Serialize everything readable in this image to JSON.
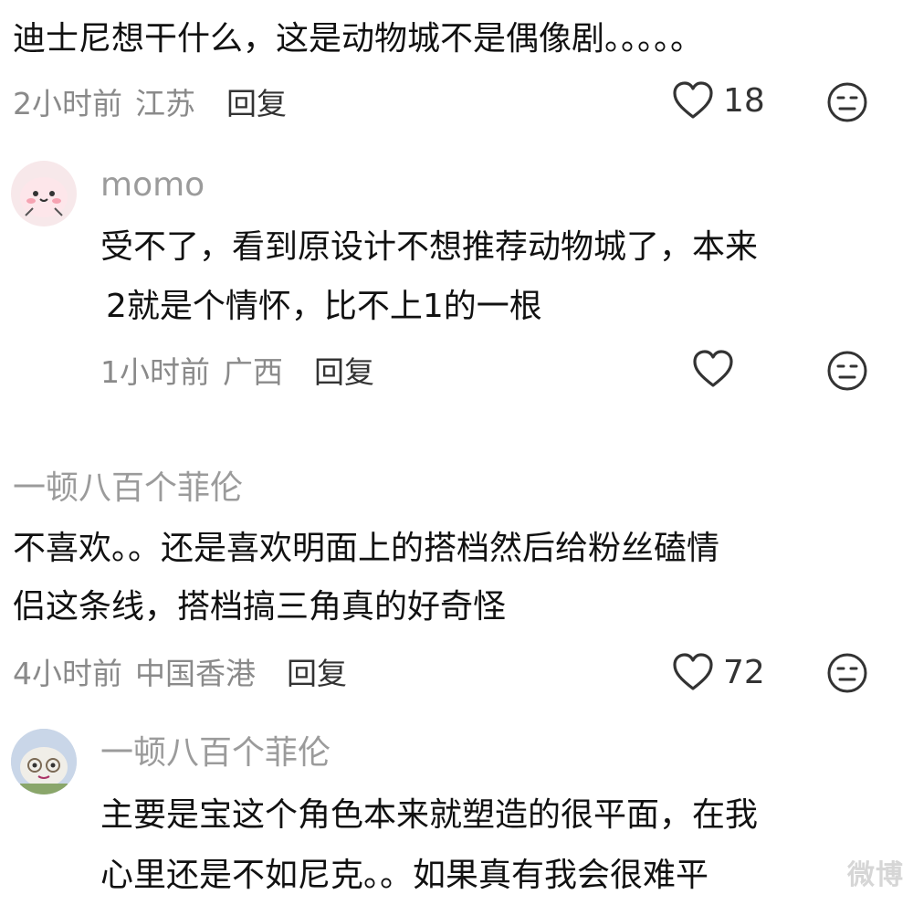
{
  "comments": [
    {
      "text": "迪士尼想干什么，这是动物城不是偶像剧。。。。。",
      "time": "2小时前",
      "location": "江苏",
      "reply_label": "回复",
      "likes": "18"
    },
    {
      "username": "momo",
      "text_line1": "受不了，看到原设计不想推荐动物城了，本来",
      "text_line2": "2就是个情怀，比不上1的一根",
      "time": "1小时前",
      "location": "广西",
      "reply_label": "回复",
      "likes": ""
    },
    {
      "username": "一顿八百个菲伦",
      "text_line1": "不喜欢。。还是喜欢明面上的搭档然后给粉丝磕情",
      "text_line2": "侣这条线，搭档搞三角真的好奇怪",
      "time": "4小时前",
      "location": "中国香港",
      "reply_label": "回复",
      "likes": "72"
    },
    {
      "username": "一顿八百个菲伦",
      "text_line1": "主要是宝这个角色本来就塑造的很平面，在我",
      "text_line2": "心里还是不如尼克。。如果真有我会很难平"
    }
  ],
  "watermark": "微博"
}
